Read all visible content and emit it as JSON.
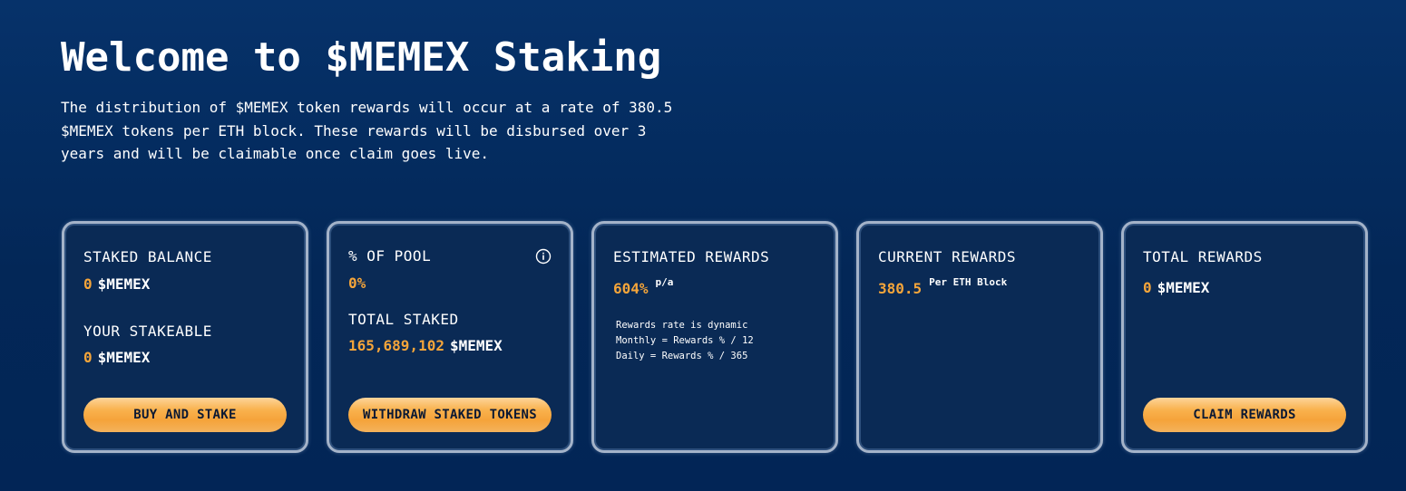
{
  "header": {
    "title": "Welcome to $MEMEX Staking",
    "intro": "The distribution of $MEMEX token rewards will occur at a rate of 380.5 $MEMEX tokens per ETH block. These rewards will be disbursed over 3 years and will be claimable once claim goes live."
  },
  "cards": {
    "staked": {
      "staked_balance_label": "STAKED BALANCE",
      "staked_balance_value": "0",
      "staked_balance_unit": "$MEMEX",
      "stakeable_label": "YOUR STAKEABLE",
      "stakeable_value": "0",
      "stakeable_unit": "$MEMEX",
      "button_label": "BUY AND STAKE"
    },
    "pool": {
      "pool_label": "% OF POOL",
      "pool_value": "0%",
      "info_icon": "info-circle-icon",
      "total_staked_label": "TOTAL STAKED",
      "total_staked_value": "165,689,102",
      "total_staked_unit": "$MEMEX",
      "button_label": "WITHDRAW STAKED TOKENS"
    },
    "estimated": {
      "label": "ESTIMATED REWARDS",
      "value": "604%",
      "suffix": "p/a",
      "note_line1": "Rewards rate is dynamic",
      "note_line2": "Monthly = Rewards % / 12",
      "note_line3": "Daily = Rewards % / 365"
    },
    "current": {
      "label": "CURRENT REWARDS",
      "value": "380.5",
      "suffix": "Per ETH Block"
    },
    "total": {
      "label": "TOTAL REWARDS",
      "value": "0",
      "unit": "$MEMEX",
      "button_label": "CLAIM REWARDS"
    }
  },
  "colors": {
    "background": "#032757",
    "card_background": "#0a2a55",
    "card_border": "#a4b3c9",
    "accent_orange": "#f5a53a",
    "button_text": "#0b1933"
  }
}
